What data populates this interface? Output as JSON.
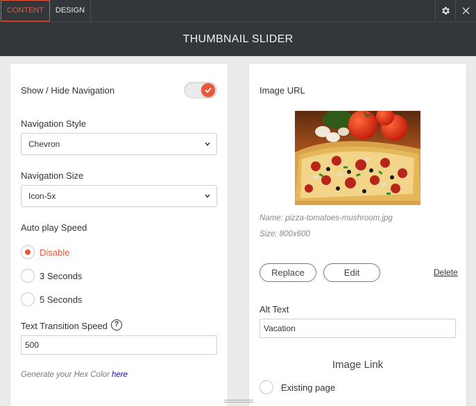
{
  "tabs": [
    {
      "label": "CONTENT",
      "active": true
    },
    {
      "label": "DESIGN",
      "active": false
    }
  ],
  "icons": {
    "settings": "gear-icon",
    "close": "close-icon"
  },
  "title": "THUMBNAIL SLIDER",
  "colors": {
    "accent": "#e8593c",
    "dark_bar": "#33373b",
    "link": "#1a0dab"
  },
  "left": {
    "show_hide_nav": {
      "label": "Show / Hide Navigation",
      "on": true
    },
    "nav_style": {
      "label": "Navigation Style",
      "value": "Chevron"
    },
    "nav_size": {
      "label": "Navigation Size",
      "value": "Icon-5x"
    },
    "autoplay": {
      "label": "Auto play Speed",
      "options": [
        "Disable",
        "3 Seconds",
        "5 Seconds"
      ],
      "selected": "Disable"
    },
    "text_transition": {
      "label": "Text Transition Speed",
      "help": "?",
      "value": "500"
    },
    "hint": {
      "text": "Generate your Hex Color",
      "link": "here"
    }
  },
  "right": {
    "image_url_label": "Image URL",
    "image_name": "Name: pizza-tomatoes-mushroom.jpg",
    "image_size": "Size: 800x600",
    "replace_label": "Replace",
    "edit_label": "Edit",
    "delete_label": "Delete",
    "alt_text": {
      "label": "Alt Text",
      "value": "Vacation"
    },
    "image_link": {
      "heading": "Image Link",
      "option": "Existing page"
    }
  }
}
